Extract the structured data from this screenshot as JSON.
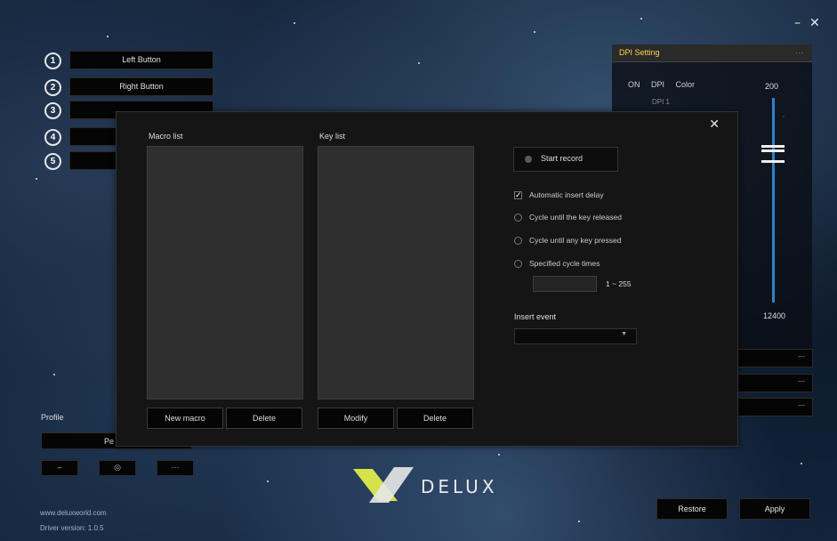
{
  "window": {
    "minimize_glyph": "–",
    "close_glyph": "✕"
  },
  "buttons_panel": {
    "items": [
      {
        "number": "1",
        "label": "Left Button"
      },
      {
        "number": "2",
        "label": "Right Button"
      },
      {
        "number": "3",
        "label": ""
      },
      {
        "number": "4",
        "label": ""
      },
      {
        "number": "5",
        "label": ""
      }
    ]
  },
  "dpi": {
    "title": "DPI Setting",
    "menu_glyph": "···",
    "col_on": "ON",
    "col_dpi": "DPI",
    "col_color": "Color",
    "row1": "DPI 1",
    "slider_max": "200",
    "slider_min": "12400",
    "strip_glyph": "—"
  },
  "profile": {
    "label": "Profile",
    "selected": "Pe",
    "btn_minus": "–",
    "btn_mid": "◎",
    "btn_more": "···"
  },
  "logo": {
    "text": "DELUX",
    "color": "#d6e24a"
  },
  "footer": {
    "website": "www.deluxworld.com",
    "version": "Driver version: 1.0.5"
  },
  "actions": {
    "restore": "Restore",
    "apply": "Apply"
  },
  "macro_dialog": {
    "close_glyph": "✕",
    "macro_list_label": "Macro list",
    "key_list_label": "Key list",
    "new_macro": "New macro",
    "delete_macro": "Delete",
    "modify": "Modify",
    "delete_key": "Delete",
    "start_record": "Start record",
    "auto_delay": "Automatic insert delay",
    "auto_delay_checked": true,
    "opt_released": "Cycle until the key released",
    "opt_any_key": "Cycle until any key pressed",
    "opt_specified": "Specified cycle times",
    "cycle_value": "",
    "cycle_range": "1 ~ 255",
    "insert_event_label": "Insert event",
    "insert_event_value": ""
  },
  "colors": {
    "accent_yellow": "#ffd54a",
    "slider_blue": "#2f80c8"
  }
}
